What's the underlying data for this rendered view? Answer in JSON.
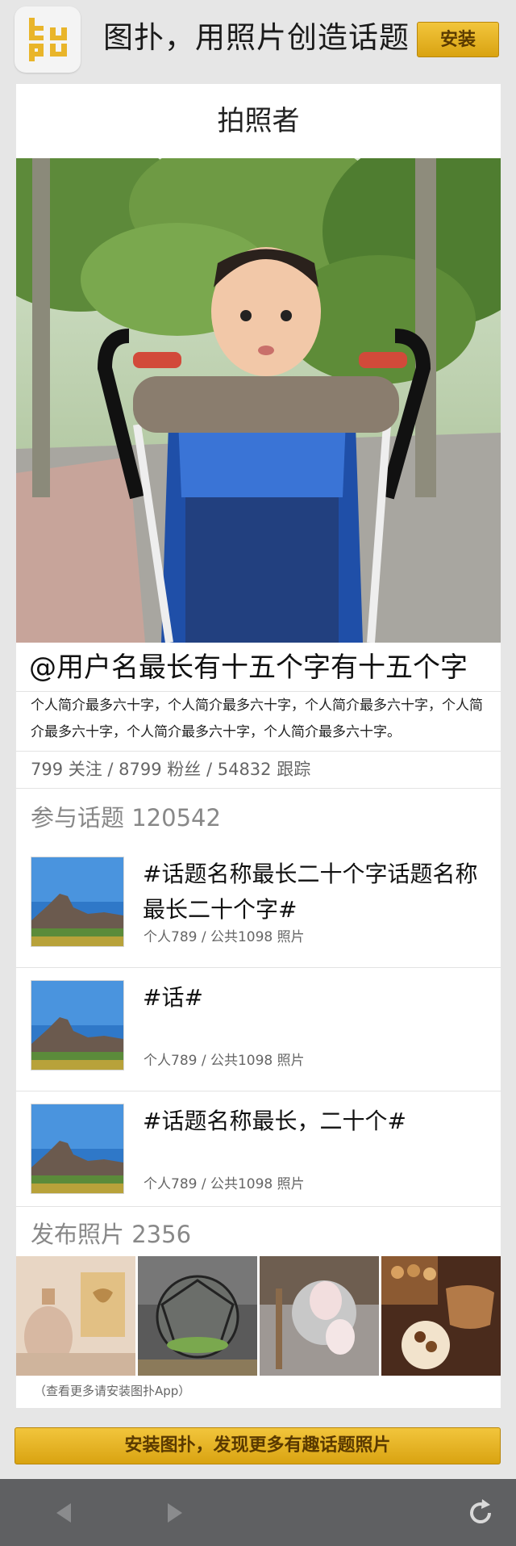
{
  "banner": {
    "logo_icon": "tupu-logo-icon",
    "title": "图扑，用照片创造话题",
    "install_label": "安装",
    "accent_color": "#e9b52a"
  },
  "profile": {
    "header_title": "拍照者",
    "username": "@用户名最长有十五个字有十五个字",
    "bio": "个人简介最多六十字，个人简介最多六十字，个人简介最多六十字，个人简介最多六十字，个人简介最多六十字，个人简介最多六十字。",
    "stats": "799 关注 / 8799 粉丝 / 54832 跟踪"
  },
  "topics_section": {
    "title": "参与话题 120542",
    "items": [
      {
        "name": "#话题名称最长二十个字话题名称最长二十个字#",
        "meta": "个人789 / 公共1098 照片"
      },
      {
        "name": "#话#",
        "meta": "个人789 / 公共1098 照片"
      },
      {
        "name": "#话题名称最长，二十个#",
        "meta": "个人789 / 公共1098 照片"
      }
    ]
  },
  "photos_section": {
    "title": "发布照片 2356",
    "more_hint": "（查看更多请安装图扑App）"
  },
  "cta_label": "安装图扑，发现更多有趣话题照片",
  "bottom_bar": {
    "back_icon": "back-arrow-icon",
    "forward_icon": "forward-arrow-icon",
    "refresh_icon": "refresh-icon"
  }
}
